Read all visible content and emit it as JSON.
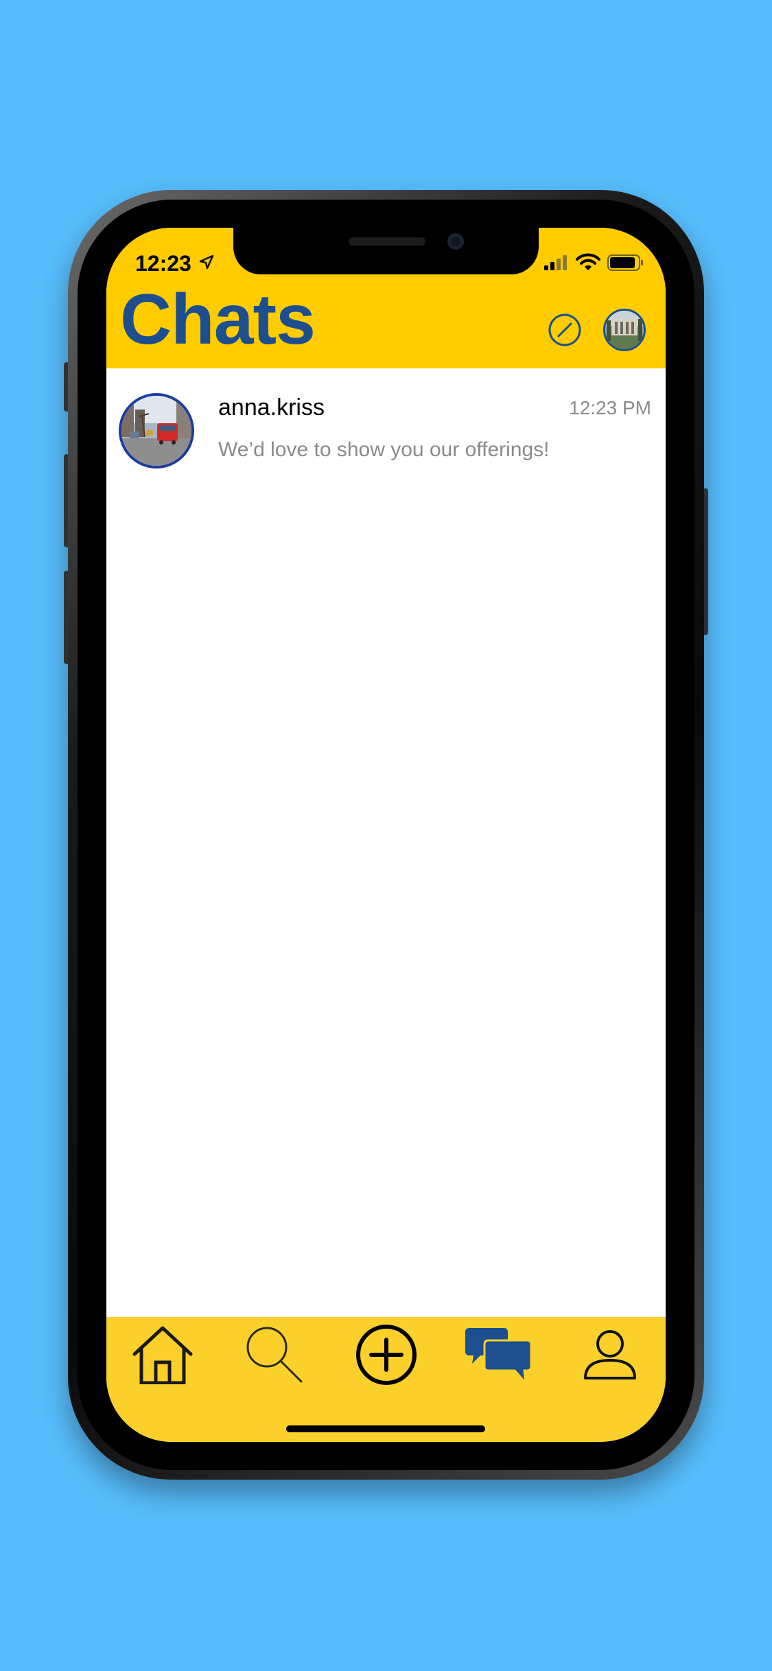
{
  "status_bar": {
    "time": "12:23"
  },
  "header": {
    "title": "Chats"
  },
  "chats": [
    {
      "name": "anna.kriss",
      "time": "12:23 PM",
      "preview": "We’d love to show you our offerings!"
    }
  ],
  "tab_bar": {
    "items": [
      "home-icon",
      "search-icon",
      "add-icon",
      "chats-icon",
      "profile-icon"
    ],
    "active": "chats-icon"
  },
  "colors": {
    "background": "#57bdfc",
    "header": "#ffcc00",
    "tabbar": "#fcd02a",
    "accent": "#1d4f8f"
  }
}
